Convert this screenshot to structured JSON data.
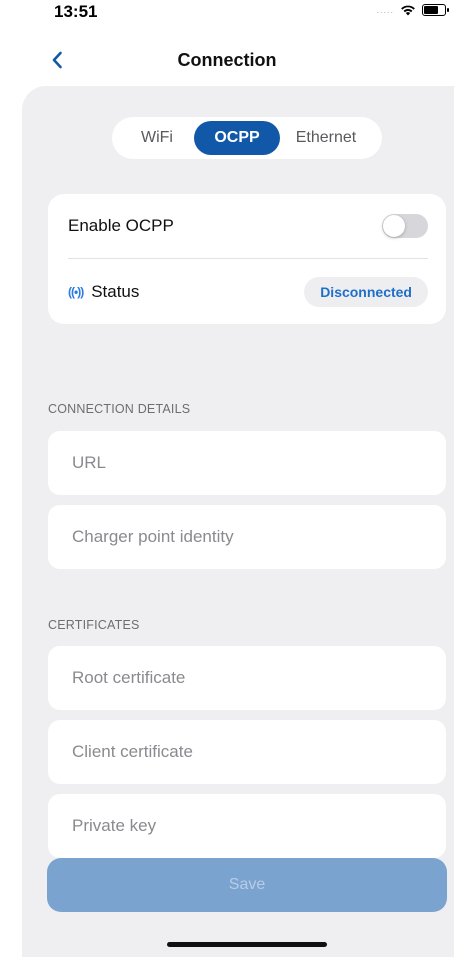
{
  "status_bar": {
    "time": "13:51",
    "signal": "....."
  },
  "nav": {
    "title": "Connection",
    "back_icon": "chevron-left-icon"
  },
  "tabs": [
    {
      "label": "WiFi",
      "selected": false
    },
    {
      "label": "OCPP",
      "selected": true
    },
    {
      "label": "Ethernet",
      "selected": false
    }
  ],
  "ocpp": {
    "enable_label": "Enable OCPP",
    "enabled": false,
    "status_icon": "((•))",
    "status_label": "Status",
    "status_value": "Disconnected"
  },
  "connection_details": {
    "header": "CONNECTION DETAILS",
    "url_placeholder": "URL",
    "url_value": "",
    "identity_placeholder": "Charger point identity",
    "identity_value": ""
  },
  "certificates": {
    "header": "CERTIFICATES",
    "root_placeholder": "Root certificate",
    "client_placeholder": "Client certificate",
    "key_placeholder": "Private key"
  },
  "save_label": "Save",
  "colors": {
    "accent": "#1159a8",
    "background": "#efeff1",
    "save_disabled": "#7ba3cf",
    "status_text": "#1f6fc8"
  }
}
